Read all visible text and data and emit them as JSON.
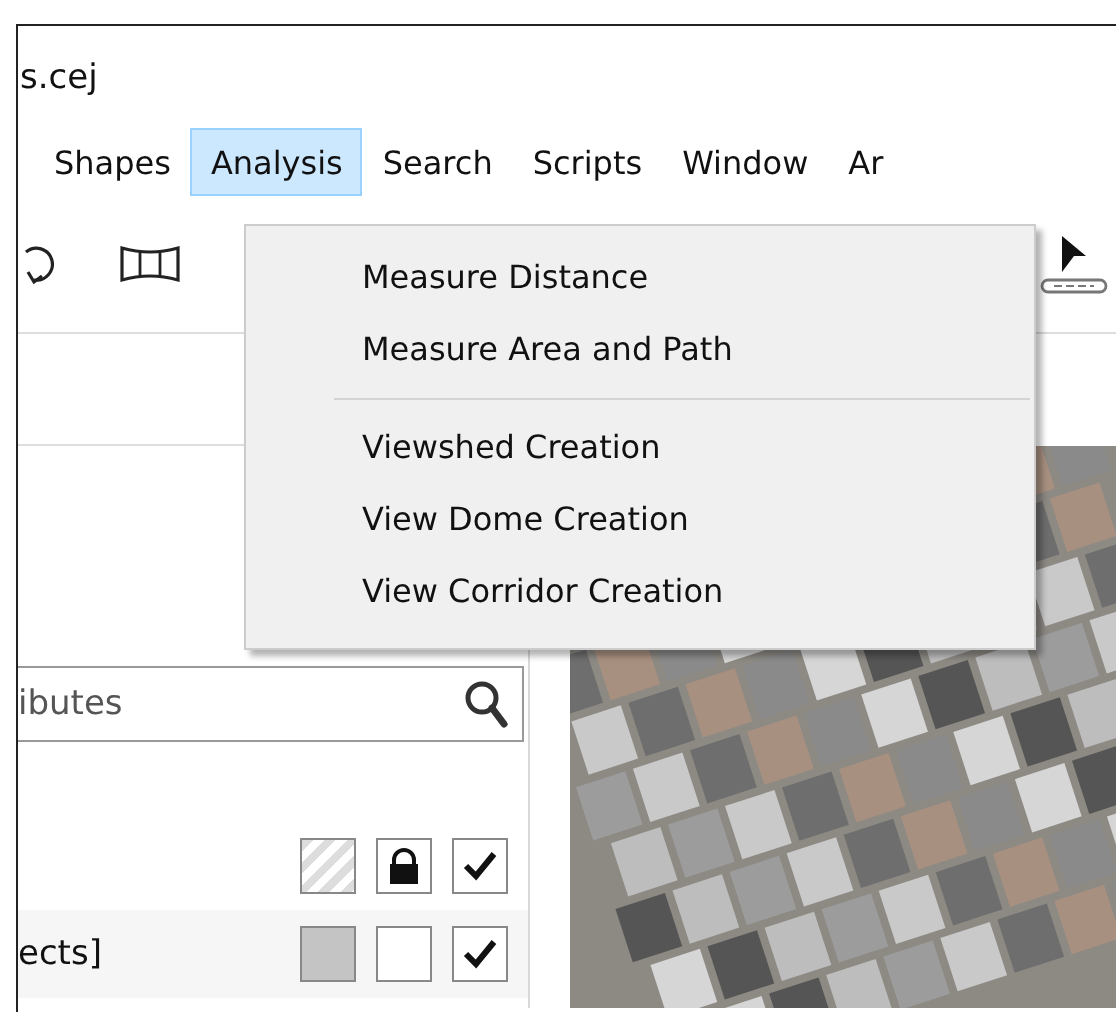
{
  "window": {
    "title": "s.cej"
  },
  "menu_bar": [
    {
      "label": "Shapes",
      "selected": false
    },
    {
      "label": "Analysis",
      "selected": true
    },
    {
      "label": "Search",
      "selected": false
    },
    {
      "label": "Scripts",
      "selected": false
    },
    {
      "label": "Window",
      "selected": false
    },
    {
      "label": "Ar",
      "selected": false
    }
  ],
  "dropdown": {
    "groups": [
      [
        "Measure Distance",
        "Measure Area and Path"
      ],
      [
        "Viewshed Creation",
        "View Dome Creation",
        "View Corridor Creation"
      ]
    ]
  },
  "layers_panel": {
    "search": {
      "placeholder": "ibutes"
    },
    "layers": [
      {
        "kind": "hatched",
        "locked": true,
        "visible": true
      },
      {
        "name": "ects]",
        "kind": "solid",
        "locked": false,
        "visible": true
      }
    ]
  }
}
